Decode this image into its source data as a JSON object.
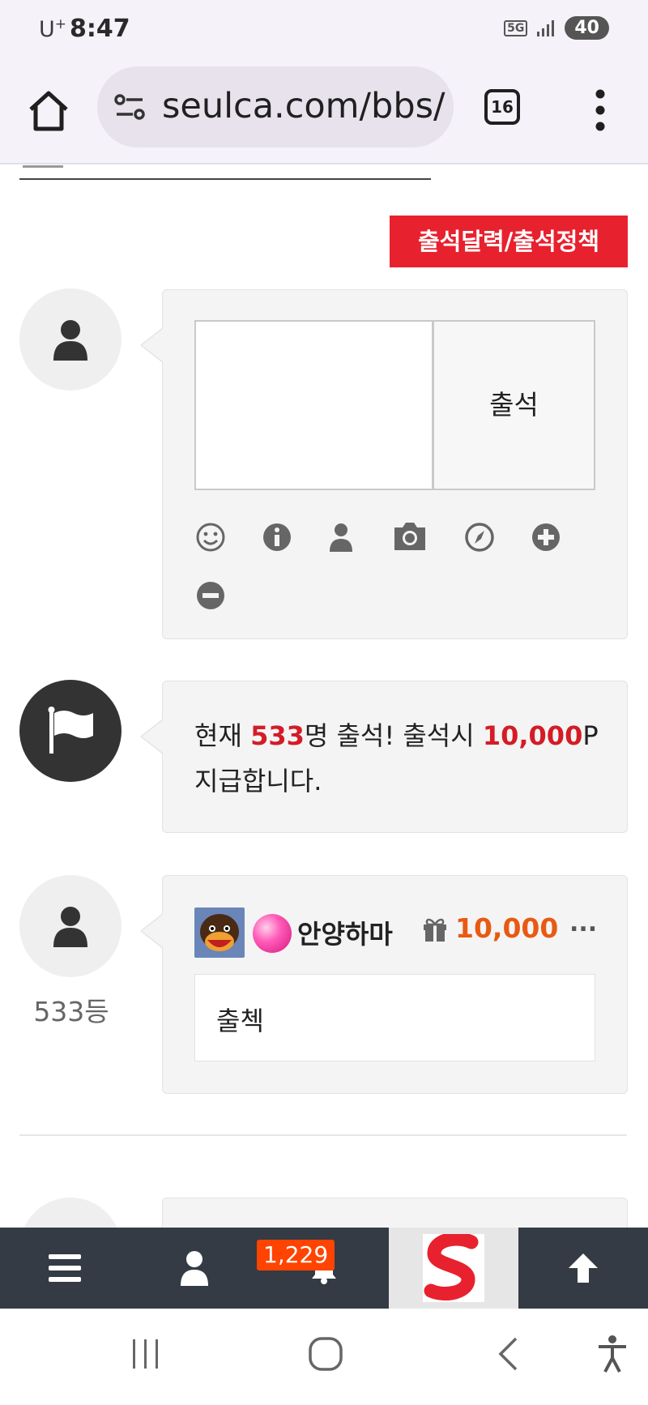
{
  "status_bar": {
    "carrier": "U",
    "carrier_sup": "+",
    "time": "8:47",
    "network": "5G",
    "battery": "40"
  },
  "browser": {
    "url": "seulca.com/bbs/",
    "tab_count": "16",
    "icons": [
      "home-icon",
      "site-settings-icon",
      "tabs-icon",
      "more-vert-icon"
    ]
  },
  "attendance": {
    "calendar_button": "출석달력/출석정책",
    "submit_label": "출석",
    "comment_value": "",
    "tool_icons": [
      "emoji-icon",
      "info-icon",
      "user-icon",
      "camera-icon",
      "compass-icon",
      "plus-circle-icon",
      "minus-circle-icon"
    ]
  },
  "notice": {
    "prefix": "현재 ",
    "count": "533",
    "middle": "명 출석! 출석시 ",
    "points": "10,000",
    "suffix_p": "P",
    "line2": "지급합니다."
  },
  "entry": {
    "rank": "533등",
    "username": "안양하마",
    "points": "10,000",
    "more": "...",
    "message": "출첵"
  },
  "site_nav": {
    "notification_count": "1,229",
    "items": [
      "menu-icon",
      "user-icon",
      "bell-icon",
      "site-logo",
      "arrow-up-icon"
    ]
  },
  "colors": {
    "accent_red": "#e8212e",
    "point_orange": "#e85a12",
    "nav_dark": "#343b44",
    "badge_orange": "#ff4400"
  }
}
